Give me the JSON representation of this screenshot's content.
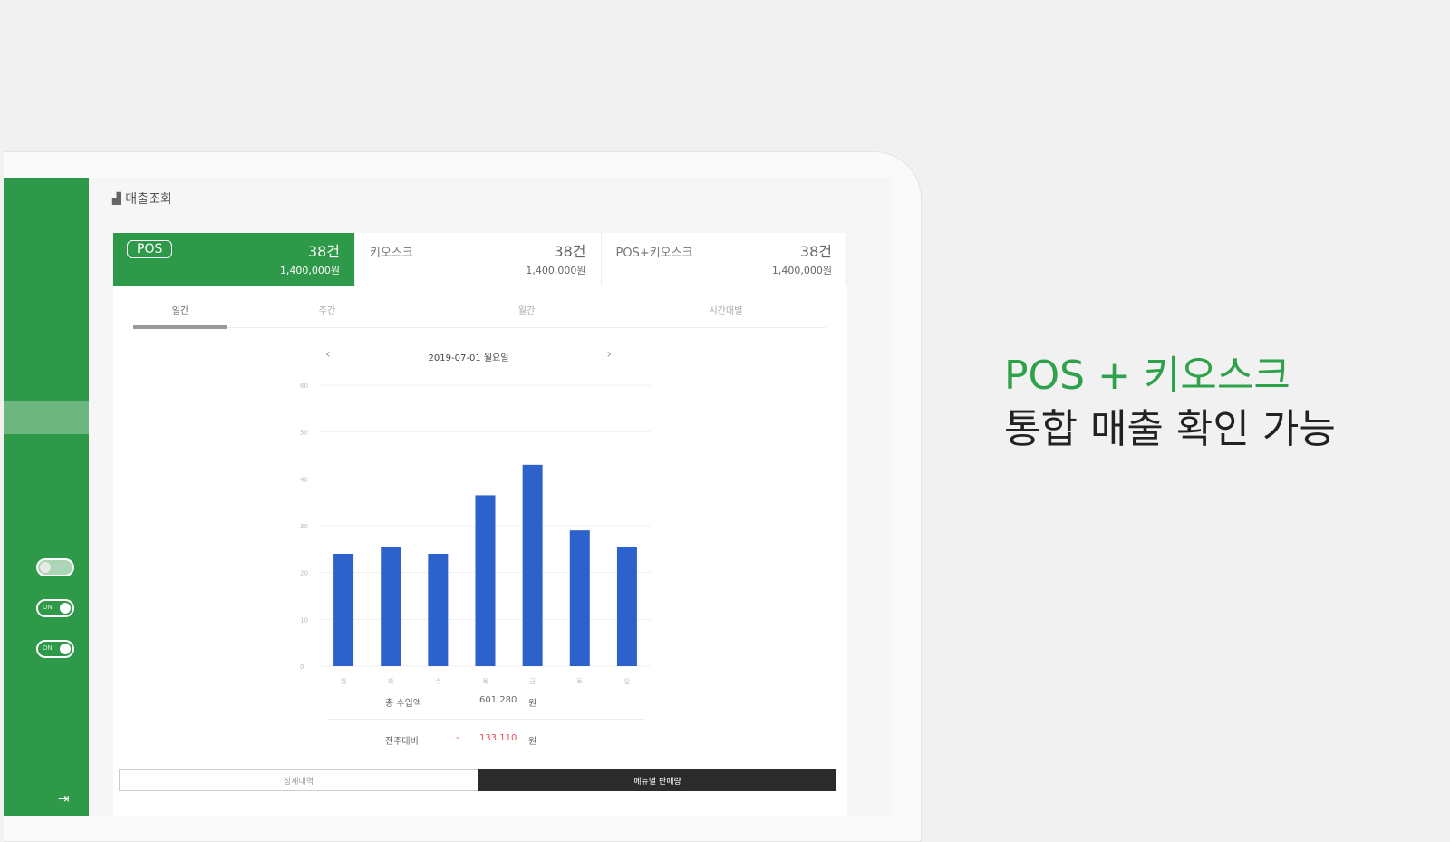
{
  "headline": {
    "line1": "POS + 키오스크",
    "line2": "통합 매출 확인 가능"
  },
  "app": {
    "page_title": "매출조회",
    "title_icon": "chart-icon",
    "sidebar": {
      "toggles": [
        {
          "label": "OFF",
          "state": "off"
        },
        {
          "label": "ON",
          "state": "on"
        },
        {
          "label": "ON",
          "state": "on"
        }
      ],
      "logout_icon": "logout-icon"
    },
    "summary_cards": [
      {
        "name": "POS",
        "count": "38건",
        "amount": "1,400,000원",
        "active": true
      },
      {
        "name": "키오스크",
        "count": "38건",
        "amount": "1,400,000원",
        "active": false
      },
      {
        "name": "POS+키오스크",
        "count": "38건",
        "amount": "1,400,000원",
        "active": false
      }
    ],
    "tabs": [
      "일간",
      "주간",
      "월간",
      "시간대별"
    ],
    "date_label": "2019-07-01 월요일",
    "stats": {
      "total_label": "총 수입액",
      "total_value": "601,280",
      "total_unit": "원",
      "diff_label": "전주대비",
      "diff_sign": "-",
      "diff_value": "133,110",
      "diff_unit": "원"
    },
    "buttons": {
      "left": "상세내역",
      "right": "메뉴별 판매량"
    },
    "colors": {
      "brand": "#2e9a49",
      "bar": "#2d62cc",
      "negative": "#e24b5a"
    }
  },
  "chart_data": {
    "type": "bar",
    "categories": [
      "월",
      "화",
      "수",
      "목",
      "금",
      "토",
      "일"
    ],
    "values": [
      24,
      25.5,
      24,
      36.5,
      43,
      29,
      25.5
    ],
    "ylim": [
      0,
      60
    ],
    "yticks": [
      "0",
      "10",
      "20",
      "30",
      "40",
      "50",
      "60"
    ],
    "grid": true
  }
}
